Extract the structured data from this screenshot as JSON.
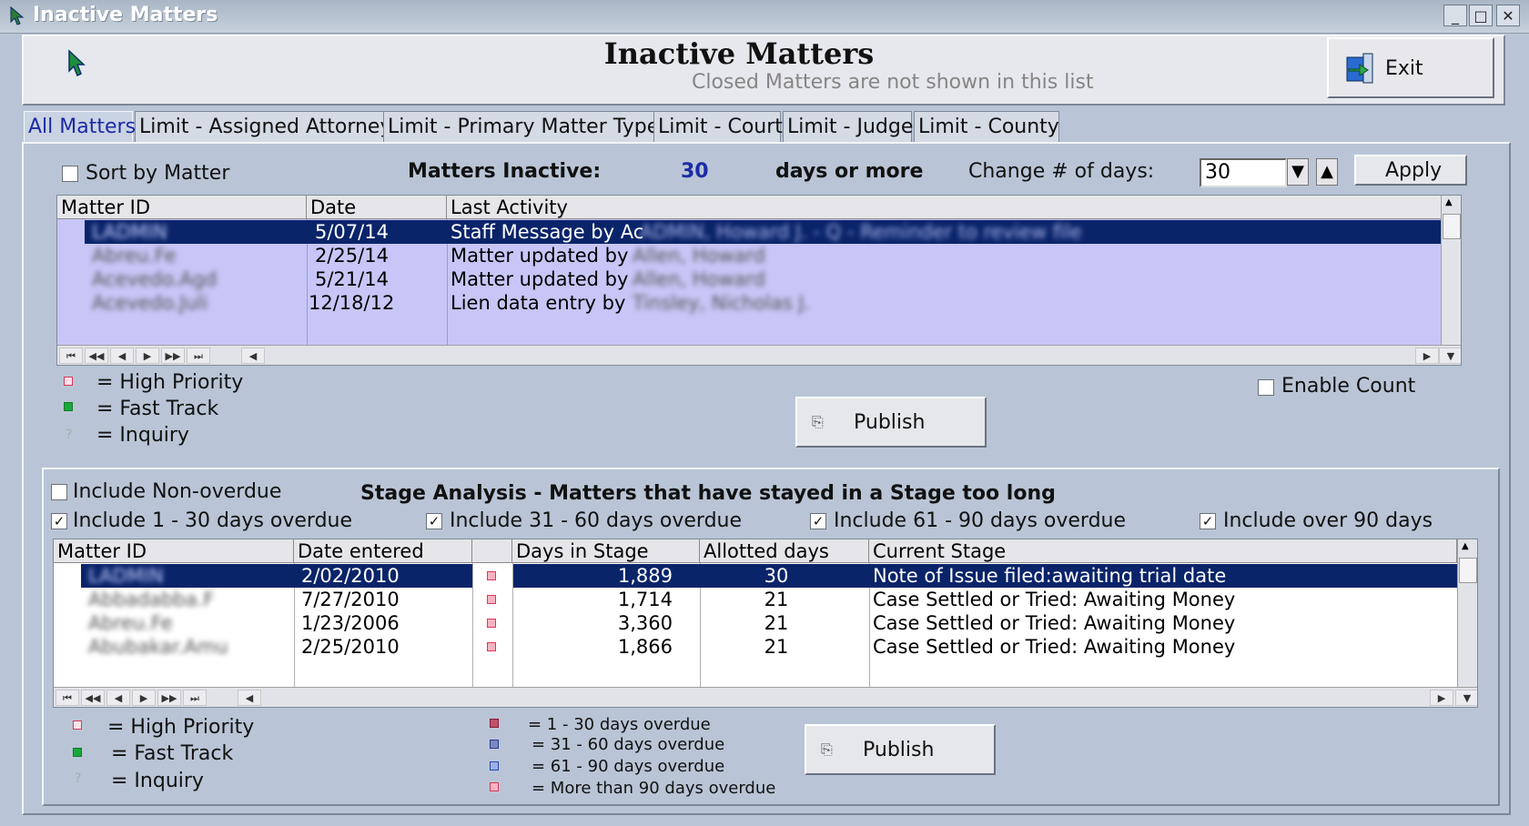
{
  "window": {
    "title": "Inactive Matters",
    "controls": [
      "_",
      "□",
      "✕"
    ]
  },
  "header": {
    "title": "Inactive Matters",
    "subtitle": "Closed Matters are not shown in this list",
    "exit_label": "Exit"
  },
  "tabs": [
    "All Matters",
    "Limit - Assigned Attorney",
    "Limit - Primary Matter Type",
    "Limit - Court",
    "Limit - Judge",
    "Limit - County"
  ],
  "filters": {
    "sort_by_matter": "Sort by Matter",
    "inactive_label": "Matters Inactive:",
    "inactive_days": "30",
    "days_suffix": "days or more",
    "change_days_label": "Change # of days:",
    "days_input": "30",
    "apply_label": "Apply"
  },
  "top_grid": {
    "columns": [
      "Matter ID",
      "Date",
      "Last Activity"
    ],
    "rows": [
      {
        "id": "LADMIN",
        "date": "5/07/14",
        "activity": "Staff Message by Ac",
        "hidden": "ADMIN, Howard J. - Q - Reminder to review file",
        "selected": true
      },
      {
        "id": "Abreu.Fe",
        "date": "2/25/14",
        "activity": "Matter updated by",
        "hidden": "Allen, Howard",
        "selected": false
      },
      {
        "id": "Acevedo.Agd",
        "date": "5/21/14",
        "activity": "Matter updated by",
        "hidden": "Allen, Howard",
        "selected": false
      },
      {
        "id": "Acevedo.Juli",
        "date": "12/18/12",
        "activity": "Lien data entry by",
        "hidden": "Tinsley, Nicholas J.",
        "selected": false
      }
    ]
  },
  "legend_top": {
    "high_priority": "= High Priority",
    "fast_track": "= Fast Track",
    "inquiry": "= Inquiry"
  },
  "enable_count": "Enable Count",
  "publish_label": "Publish",
  "stage": {
    "include_non_overdue": "Include Non-overdue",
    "title": "Stage Analysis - Matters that have stayed in a Stage too long",
    "include_1_30": "Include 1 - 30 days overdue",
    "include_31_60": "Include 31 - 60 days overdue",
    "include_61_90": "Include 61 - 90 days overdue",
    "include_over_90": "Include over 90 days",
    "columns": [
      "Matter ID",
      "Date entered",
      "",
      "Days in Stage",
      "Allotted days",
      "Current Stage"
    ],
    "rows": [
      {
        "id": "LADMIN",
        "date": "2/02/2010",
        "days": "1,889",
        "allotted": "30",
        "stage": "Note of Issue filed:awaiting trial date",
        "selected": true
      },
      {
        "id": "Abbadabba.F",
        "date": "7/27/2010",
        "days": "1,714",
        "allotted": "21",
        "stage": "Case Settled or Tried:  Awaiting Money",
        "selected": false
      },
      {
        "id": "Abreu.Fe",
        "date": "1/23/2006",
        "days": "3,360",
        "allotted": "21",
        "stage": "Case Settled or Tried:  Awaiting Money",
        "selected": false
      },
      {
        "id": "Abubakar.Amu",
        "date": "2/25/2010",
        "days": "1,866",
        "allotted": "21",
        "stage": "Case Settled or Tried:  Awaiting Money",
        "selected": false
      }
    ]
  },
  "legend_bottom": {
    "high_priority": "= High Priority",
    "fast_track": "= Fast Track",
    "inquiry": "= Inquiry",
    "od_1_30": "= 1 - 30 days overdue",
    "od_31_60": "= 31 - 60 days overdue",
    "od_61_90": "= 61 - 90 days overdue",
    "od_90": "= More than 90 days overdue"
  },
  "colors": {
    "selection": "#0a246a",
    "grid_top_bg": "#c8c6f7",
    "accent_blue": "#1c2aa5",
    "priority_red": "#d8395a",
    "fast_track_green": "#1aa83a"
  }
}
